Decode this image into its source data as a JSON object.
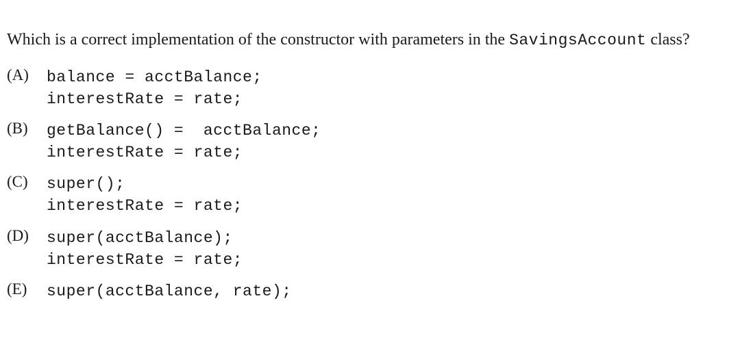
{
  "question": {
    "part1": "Which is a correct implementation of the constructor with parameters in the ",
    "class_name": "SavingsAccount",
    "part2": " class?"
  },
  "options": [
    {
      "label": "(A)",
      "code": "balance = acctBalance;\ninterestRate = rate;"
    },
    {
      "label": "(B)",
      "code": "getBalance() =  acctBalance;\ninterestRate = rate;"
    },
    {
      "label": "(C)",
      "code": "super();\ninterestRate = rate;"
    },
    {
      "label": "(D)",
      "code": "super(acctBalance);\ninterestRate = rate;"
    },
    {
      "label": "(E)",
      "code": "super(acctBalance, rate);"
    }
  ]
}
